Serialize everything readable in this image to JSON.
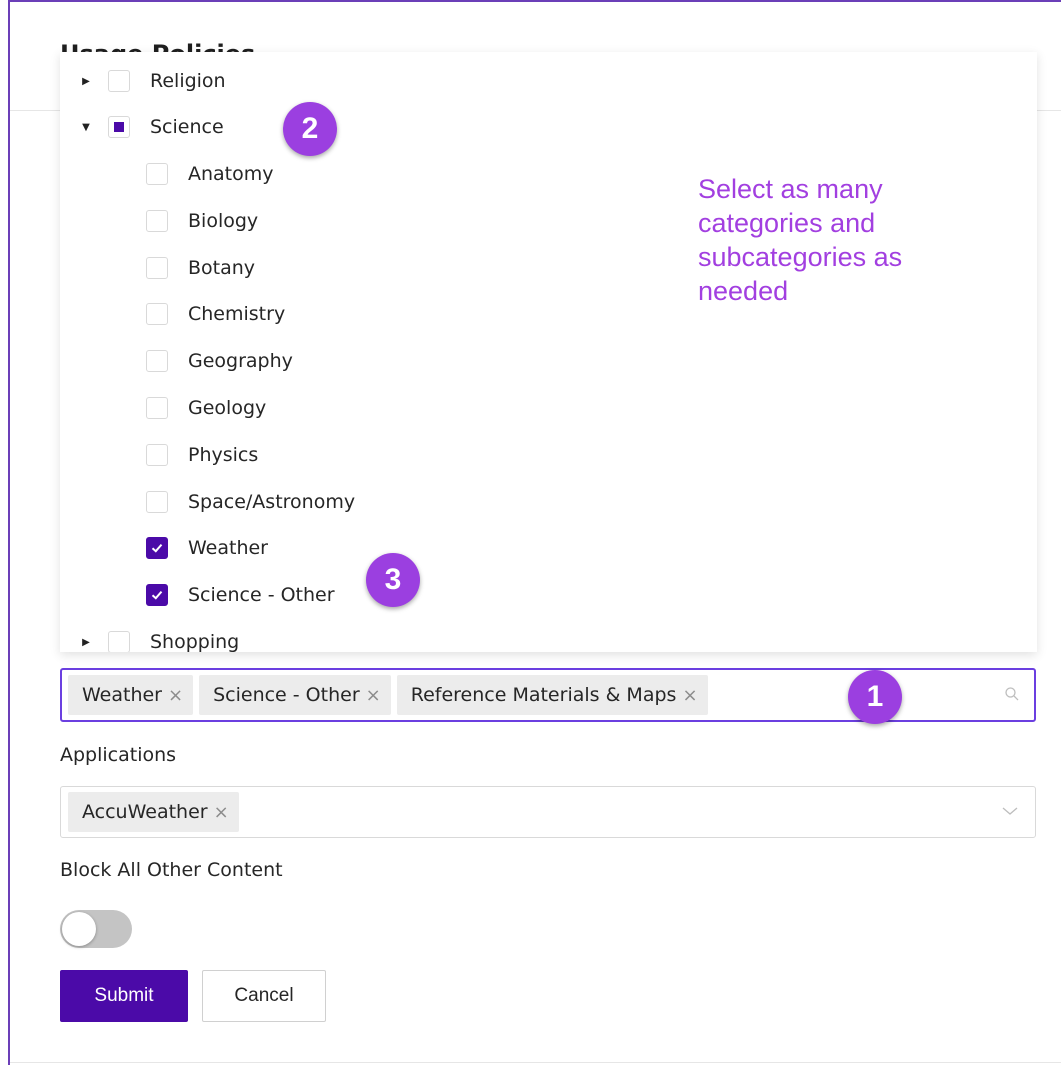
{
  "page": {
    "title": "Usage Policies"
  },
  "tree": {
    "items": [
      {
        "label": "Religion",
        "level": 0,
        "state": "unchecked",
        "caret": "collapsed"
      },
      {
        "label": "Science",
        "level": 0,
        "state": "indeterminate",
        "caret": "expanded"
      },
      {
        "label": "Anatomy",
        "level": 1,
        "state": "unchecked"
      },
      {
        "label": "Biology",
        "level": 1,
        "state": "unchecked"
      },
      {
        "label": "Botany",
        "level": 1,
        "state": "unchecked"
      },
      {
        "label": "Chemistry",
        "level": 1,
        "state": "unchecked"
      },
      {
        "label": "Geography",
        "level": 1,
        "state": "unchecked"
      },
      {
        "label": "Geology",
        "level": 1,
        "state": "unchecked"
      },
      {
        "label": "Physics",
        "level": 1,
        "state": "unchecked"
      },
      {
        "label": "Space/Astronomy",
        "level": 1,
        "state": "unchecked"
      },
      {
        "label": "Weather",
        "level": 1,
        "state": "checked"
      },
      {
        "label": "Science - Other",
        "level": 1,
        "state": "checked"
      },
      {
        "label": "Shopping",
        "level": 0,
        "state": "unchecked",
        "caret": "collapsed"
      }
    ]
  },
  "annotation": {
    "text": "Select as many categories and subcategories as needed"
  },
  "badges": {
    "one": "1",
    "two": "2",
    "three": "3"
  },
  "categories_input": {
    "tags": [
      {
        "label": "Weather"
      },
      {
        "label": "Science - Other"
      },
      {
        "label": "Reference Materials & Maps"
      }
    ],
    "remove_glyph": "×",
    "icon": "search-icon"
  },
  "applications": {
    "label": "Applications",
    "tags": [
      {
        "label": "AccuWeather"
      }
    ],
    "icon": "chevron-down-icon"
  },
  "block_all": {
    "label": "Block All Other Content",
    "enabled": false
  },
  "buttons": {
    "submit": "Submit",
    "cancel": "Cancel"
  },
  "colors": {
    "accent": "#4b0aa8",
    "annotation": "#a23fe0",
    "badge": "#9b3fe0",
    "focus_border": "#6b3fe0"
  }
}
